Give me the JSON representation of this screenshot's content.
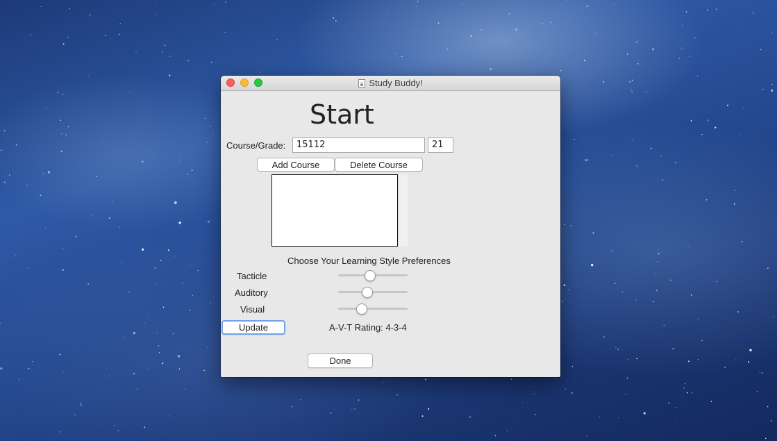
{
  "window": {
    "title": "Study Buddy!"
  },
  "main": {
    "heading": "Start",
    "course_label": "Course/Grade:",
    "course_value": "15112",
    "grade_value": "21",
    "add_course": "Add Course",
    "delete_course": "Delete Course",
    "courses": [],
    "prefs_heading": "Choose Your Learning Style Preferences",
    "sliders": [
      {
        "label": "Tacticle",
        "value": 0.46
      },
      {
        "label": "Auditory",
        "value": 0.42
      },
      {
        "label": "Visual",
        "value": 0.34
      }
    ],
    "update": "Update",
    "rating": "A-V-T Rating: 4-3-4",
    "done": "Done"
  },
  "colors": {
    "accent": "#6fa2e8",
    "close": "#fc5f57",
    "minimize": "#fdbc2e",
    "maximize": "#29c940"
  }
}
